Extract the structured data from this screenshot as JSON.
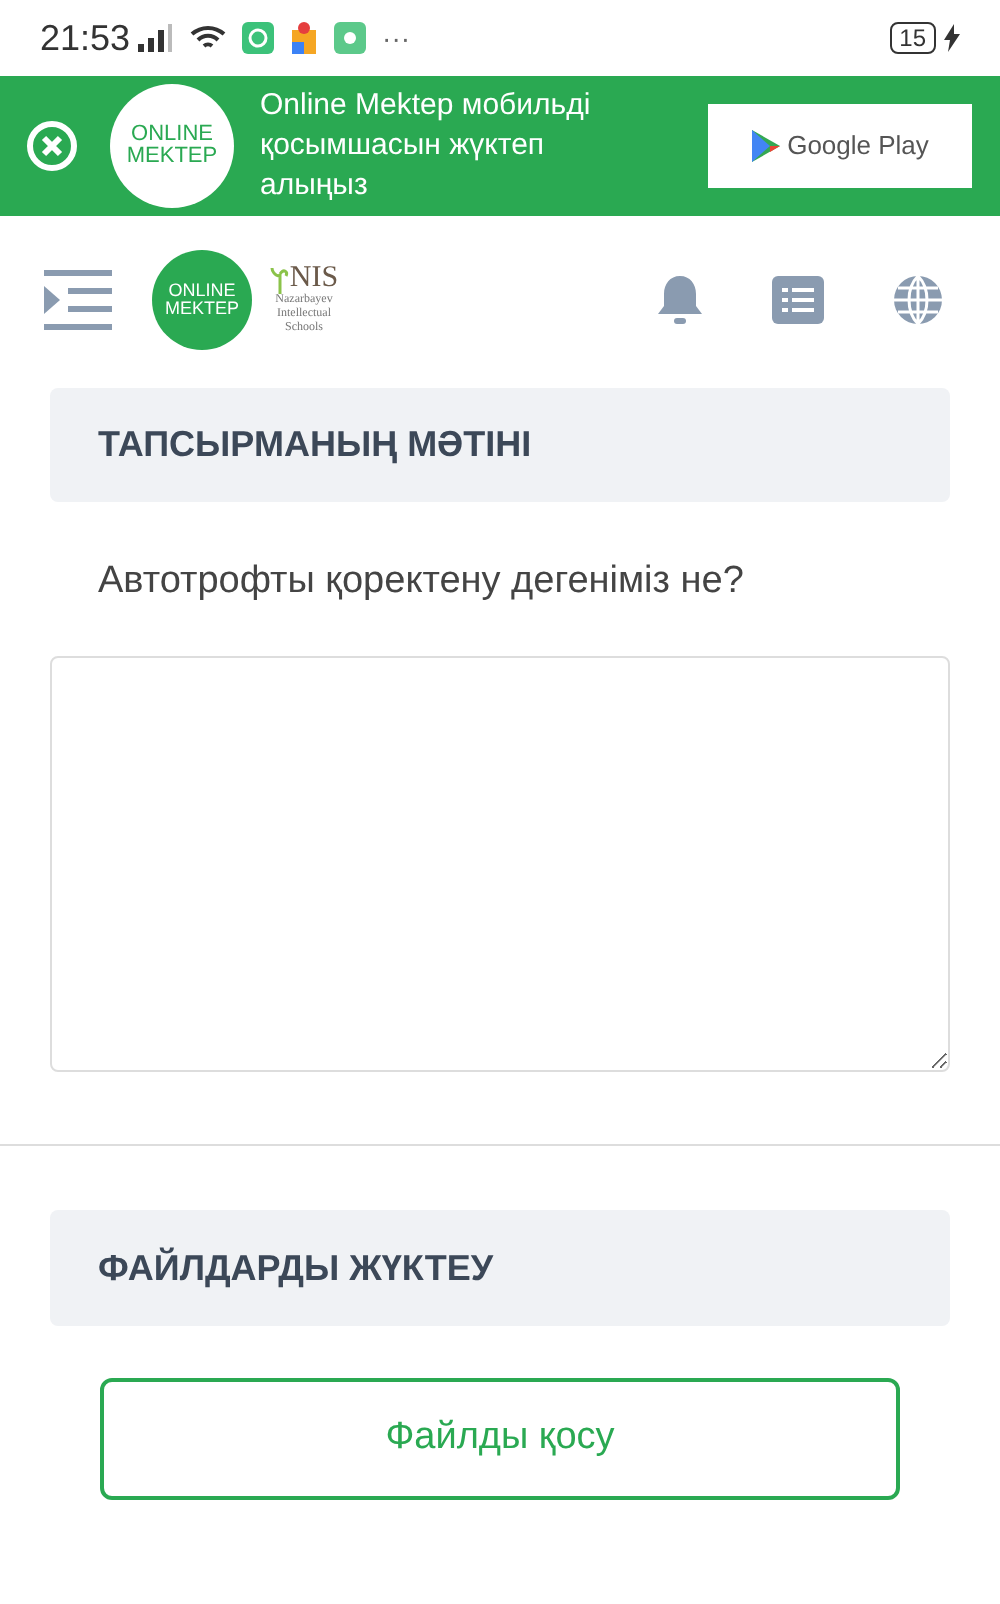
{
  "status_bar": {
    "time": "21:53",
    "more": "···",
    "battery": "15"
  },
  "banner": {
    "logo_line_1": "ONLINE",
    "logo_line_2": "MEKTEP",
    "message": "Online Mektep мобильді қосымшасын жүктеп алыңыз",
    "store_button": "Google Play"
  },
  "header": {
    "logo_line_1": "ONLINE",
    "logo_line_2": "MEKTEP",
    "nis_title": "NIS",
    "nis_subtitle": "Nazarbayev Intellectual Schools"
  },
  "task": {
    "title": "ТАПСЫРМАНЫҢ МӘТІНІ",
    "question": "Автотрофты қоректену дегеніміз не?"
  },
  "upload": {
    "title": "ФАЙЛДАРДЫ ЖҮКТЕУ",
    "button": "Файлды қосу"
  }
}
